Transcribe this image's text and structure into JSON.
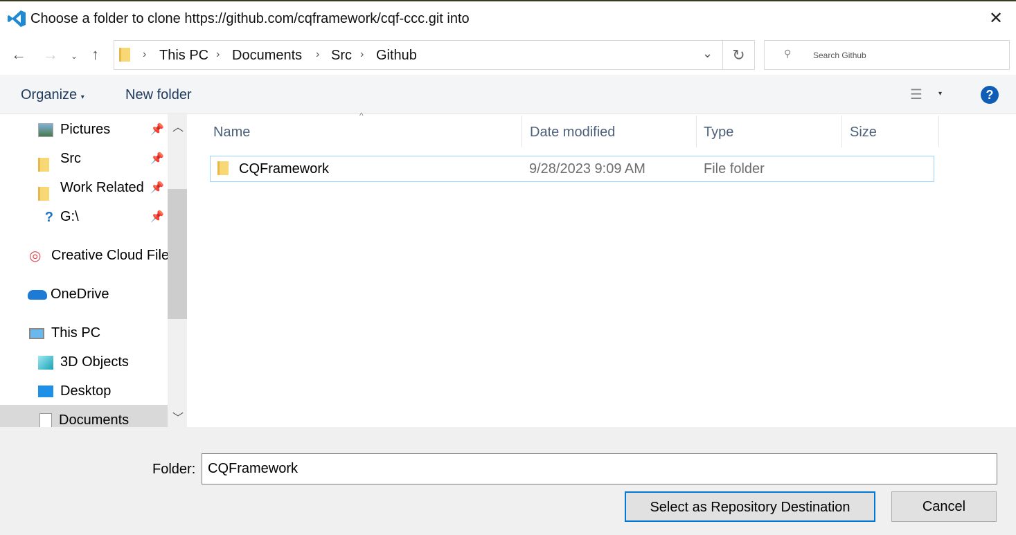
{
  "window": {
    "title": "Choose a folder to clone https://github.com/cqframework/cqf-ccc.git into",
    "close_icon": "close-icon",
    "app_icon": "vscode-icon"
  },
  "nav": {
    "breadcrumbs": [
      "This PC",
      "Documents",
      "Src",
      "Github"
    ],
    "search_placeholder": "Search Github"
  },
  "toolbar": {
    "organize": "Organize",
    "new_folder": "New folder",
    "help": "?"
  },
  "sidebar": {
    "items": [
      {
        "label": "Pictures",
        "icon": "pictures-icon",
        "pinned": true
      },
      {
        "label": "Src",
        "icon": "folder-icon",
        "pinned": true
      },
      {
        "label": "Work Related",
        "icon": "folder-icon",
        "pinned": true
      },
      {
        "label": "G:\\",
        "icon": "drive-icon",
        "pinned": true
      },
      {
        "label": "Creative Cloud Files",
        "icon": "creative-cloud-icon"
      },
      {
        "label": "OneDrive",
        "icon": "onedrive-icon"
      },
      {
        "label": "This PC",
        "icon": "computer-icon"
      },
      {
        "label": "3D Objects",
        "icon": "3d-objects-icon"
      },
      {
        "label": "Desktop",
        "icon": "desktop-icon"
      },
      {
        "label": "Documents",
        "icon": "documents-icon",
        "selected": true
      }
    ]
  },
  "files": {
    "columns": [
      "Name",
      "Date modified",
      "Type",
      "Size"
    ],
    "rows": [
      {
        "name": "CQFramework",
        "date": "9/28/2023 9:09 AM",
        "type": "File folder",
        "size": ""
      }
    ]
  },
  "footer": {
    "folder_label": "Folder:",
    "folder_value": "CQFramework",
    "select_button": "Select as Repository Destination",
    "cancel_button": "Cancel"
  },
  "colors": {
    "accent": "#0078d7",
    "selection_border": "#99d1ff",
    "help": "#0f5db5"
  }
}
